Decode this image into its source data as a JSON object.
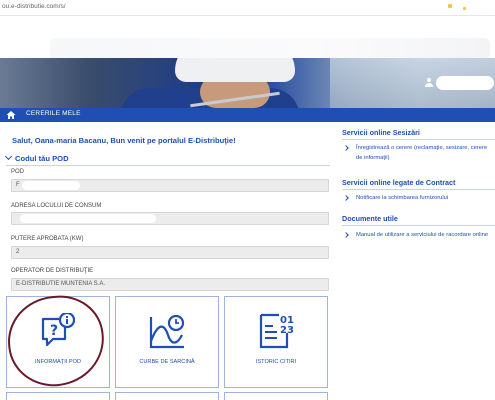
{
  "browser": {
    "url": "ou.e-distributie.com/s/"
  },
  "nav": {
    "breadcrumb": "CERERILE MELE"
  },
  "greeting": "Salut, Oana-maria Bacanu, Bun venit pe portalul E-Distribuţie!",
  "pod_section": {
    "title": "Codul tău POD",
    "fields": [
      {
        "label": "POD",
        "value": "F"
      },
      {
        "label": "ADRESA LOCULUI DE CONSUM",
        "value": ""
      },
      {
        "label": "PUTERE APROBATA (kW)",
        "value": "2"
      },
      {
        "label": "OPERATOR DE DISTRIBUŢIE",
        "value": "E-DISTRIBUTIE MUNTENIA S.A."
      }
    ]
  },
  "tiles": [
    {
      "label": "INFORMAŢII POD",
      "icon": "info-question-icon"
    },
    {
      "label": "CURBE DE SARCINĂ",
      "icon": "load-curve-icon"
    },
    {
      "label": "ISTORIC CITIRI",
      "icon": "reading-history-icon"
    }
  ],
  "right_panel": {
    "sections": [
      {
        "title": "Servicii online Sesizări",
        "links": [
          "Înregistrează o cerere (reclamaţie, sesizare, cerere de informaţii)"
        ]
      },
      {
        "title": "Servicii online legate de Contract",
        "links": [
          "Notificare la schimbarea furnizorului"
        ]
      },
      {
        "title": "Documente utile",
        "links": [
          "Manual de utilizare a serviciului de racordare online"
        ]
      }
    ]
  },
  "colors": {
    "brand_blue": "#1f4fb3",
    "annotation_circle": "#6b1a2a"
  }
}
